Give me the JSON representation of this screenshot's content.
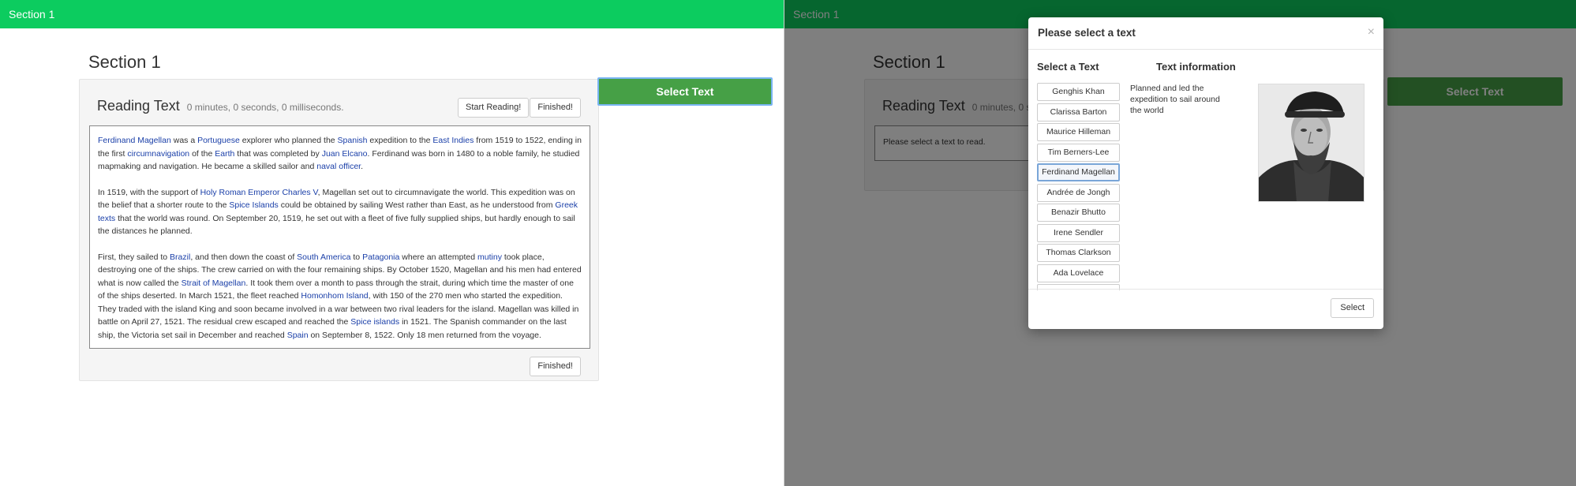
{
  "left": {
    "topbar": "Section 1",
    "section_title": "Section 1",
    "panel": {
      "title": "Reading Text",
      "timer": "0 minutes, 0 seconds, 0 milliseconds.",
      "start_button": "Start Reading!",
      "finished_button": "Finished!",
      "finished_bottom_button": "Finished!"
    },
    "select_text_button": "Select Text"
  },
  "right": {
    "topbar": "Section 1",
    "section_title": "Section 1",
    "panel": {
      "title": "Reading Text",
      "timer": "0 minutes, 0 seconds, 0 milliseconds.",
      "placeholder": "Please select a text to read."
    },
    "select_text_button": "Select Text",
    "modal": {
      "title": "Please select a text",
      "close": "×",
      "list_heading": "Select a Text",
      "info_heading": "Text information",
      "texts": [
        {
          "label": "Genghis Khan"
        },
        {
          "label": "Clarissa Barton"
        },
        {
          "label": "Maurice Hilleman"
        },
        {
          "label": "Tim Berners-Lee"
        },
        {
          "label": "Ferdinand Magellan"
        },
        {
          "label": "Andrée de Jongh"
        },
        {
          "label": "Benazir Bhutto"
        },
        {
          "label": "Irene Sendler"
        },
        {
          "label": "Thomas Clarkson"
        },
        {
          "label": "Ada Lovelace"
        },
        {
          "label": ""
        }
      ],
      "selected": "Ferdinand Magellan",
      "info_text": "Planned and led the expedition to sail around the world",
      "select_button": "Select"
    }
  },
  "colors": {
    "topbar_left": "#0ccc5f",
    "select_button": "#46a046",
    "link": "#1a3fa8"
  },
  "reading_paragraphs": [
    [
      {
        "t": "Ferdinand Magellan",
        "link": true
      },
      {
        "t": " was a "
      },
      {
        "t": "Portuguese",
        "link": true
      },
      {
        "t": " explorer who planned the "
      },
      {
        "t": "Spanish",
        "link": true
      },
      {
        "t": " expedition to the "
      },
      {
        "t": "East Indies",
        "link": true
      },
      {
        "t": " from 1519 to 1522, ending in the first "
      },
      {
        "t": "circumnavigation",
        "link": true
      },
      {
        "t": " of the "
      },
      {
        "t": "Earth",
        "link": true
      },
      {
        "t": " that was completed by "
      },
      {
        "t": "Juan Elcano",
        "link": true
      },
      {
        "t": ". Ferdinand was born in 1480 to a noble family, he studied mapmaking and navigation. He became a skilled sailor and "
      },
      {
        "t": "naval officer",
        "link": true
      },
      {
        "t": "."
      }
    ],
    [
      {
        "t": "In 1519, with the support of "
      },
      {
        "t": "Holy Roman Emperor Charles V",
        "link": true
      },
      {
        "t": ", Magellan set out to circumnavigate the world. This expedition was on the belief that a shorter route to the "
      },
      {
        "t": "Spice Islands",
        "link": true
      },
      {
        "t": " could be obtained by sailing West rather than East, as he understood from "
      },
      {
        "t": "Greek texts",
        "link": true
      },
      {
        "t": " that the world was round. On September 20, 1519, he set out with a fleet of five fully supplied ships, but hardly enough to sail the distances he planned."
      }
    ],
    [
      {
        "t": "First, they sailed to "
      },
      {
        "t": "Brazil",
        "link": true
      },
      {
        "t": ", and then down the coast of "
      },
      {
        "t": "South America",
        "link": true
      },
      {
        "t": " to "
      },
      {
        "t": "Patagonia",
        "link": true
      },
      {
        "t": " where an attempted "
      },
      {
        "t": "mutiny",
        "link": true
      },
      {
        "t": " took place, destroying one of the ships. The crew carried on with the four remaining ships. By October 1520, Magellan and his men had entered what is now called the "
      },
      {
        "t": "Strait of Magellan",
        "link": true
      },
      {
        "t": ". It took them over a month to pass through the strait, during which time the master of one of the ships deserted. In March 1521, the fleet reached "
      },
      {
        "t": "Homonhom Island",
        "link": true
      },
      {
        "t": ", with 150 of the 270 men who started the expedition. They traded with the island King and soon became involved in a war between two rival leaders for the island. Magellan was killed in battle on April 27, 1521. The residual crew escaped and reached the "
      },
      {
        "t": "Spice islands",
        "link": true
      },
      {
        "t": " in 1521. The Spanish commander on the last ship, the Victoria set sail in December and reached "
      },
      {
        "t": "Spain",
        "link": true
      },
      {
        "t": " on September 8, 1522. Only 18 men returned from the voyage."
      }
    ]
  ]
}
